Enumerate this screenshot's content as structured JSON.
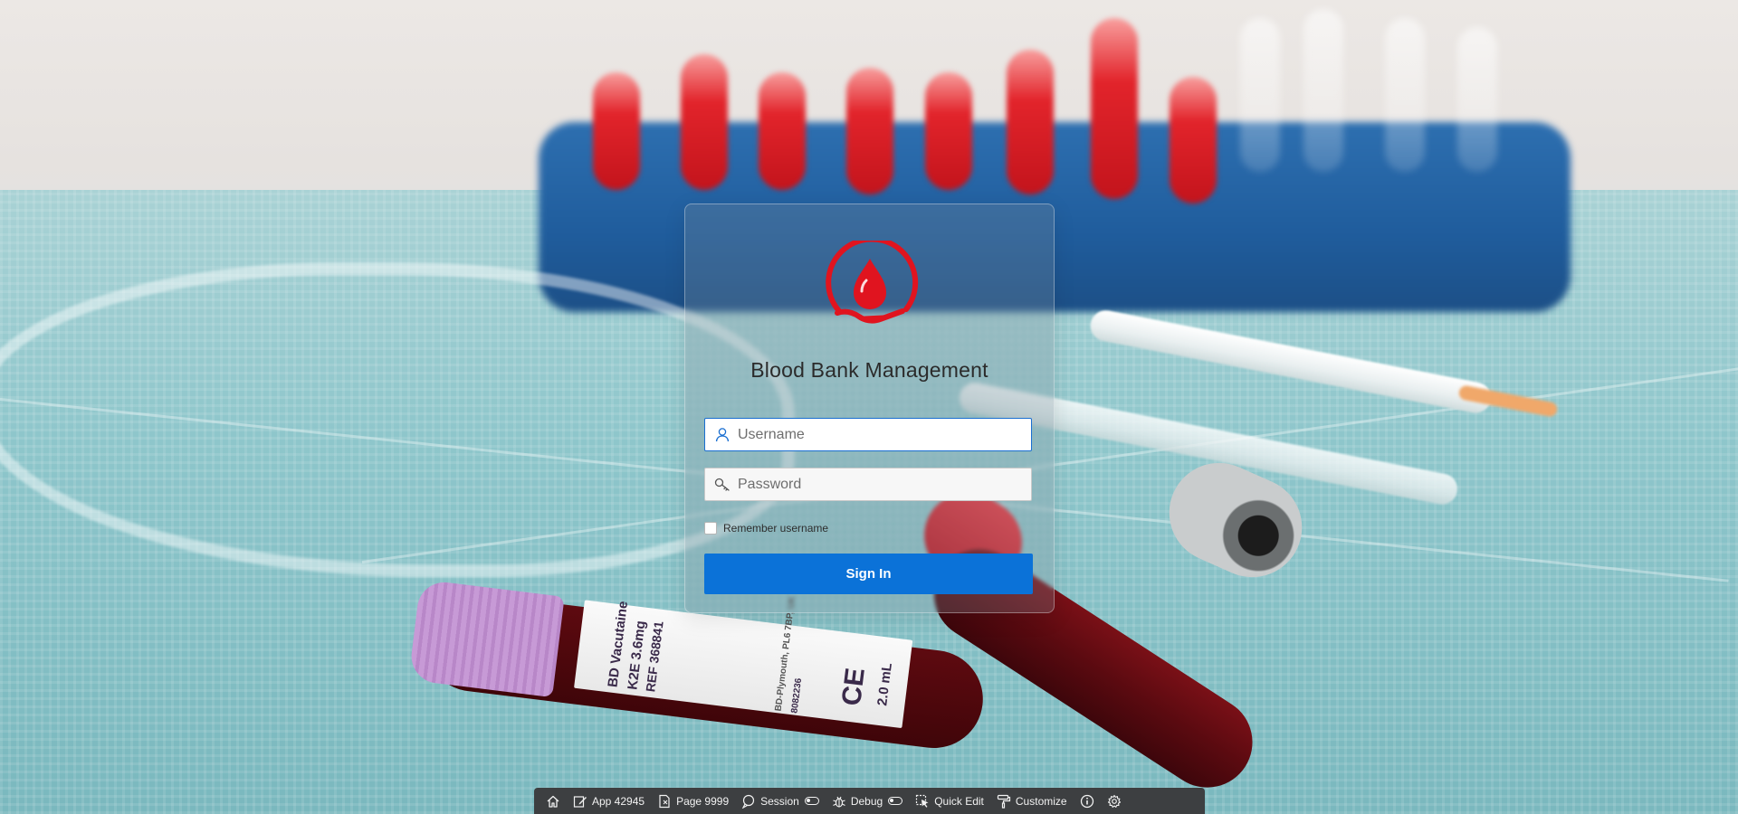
{
  "login": {
    "app_title": "Blood Bank Management",
    "username_placeholder": "Username",
    "password_placeholder": "Password",
    "remember_label": "Remember username",
    "sign_in_label": "Sign In"
  },
  "toolbar": {
    "items": [
      {
        "icon": "home-icon",
        "label": ""
      },
      {
        "icon": "edit-icon",
        "label": "App 42945"
      },
      {
        "icon": "page-icon",
        "label": "Page 9999"
      },
      {
        "icon": "session-icon",
        "label": "Session"
      },
      {
        "icon": "bug-icon",
        "label": "Debug"
      },
      {
        "icon": "quick-edit-icon",
        "label": "Quick Edit"
      },
      {
        "icon": "paint-roller-icon",
        "label": "Customize"
      },
      {
        "icon": "info-icon",
        "label": ""
      },
      {
        "icon": "gear-icon",
        "label": ""
      }
    ]
  },
  "background_label": {
    "line1": "BD Vacutaine",
    "line2": "K2E 3.6mg",
    "line3": "REF 368841",
    "line4": "BD-Plymouth, PL6 7BP, UK",
    "line5": "8082236",
    "line6": "CE",
    "line7": "2.0 mL"
  },
  "colors": {
    "accent": "#0b72d8",
    "logo_red": "#e0141f",
    "toolbar_bg": "#3d3f41"
  }
}
